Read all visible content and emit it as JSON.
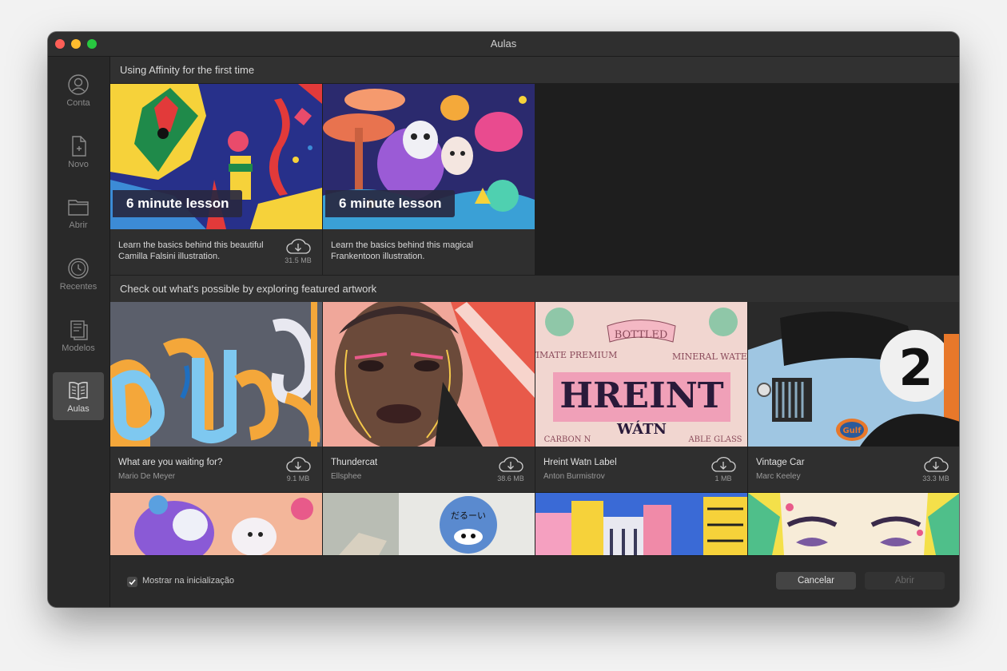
{
  "window": {
    "title": "Aulas"
  },
  "sidebar": {
    "items": [
      {
        "label": "Conta",
        "icon": "account-icon"
      },
      {
        "label": "Novo",
        "icon": "new-document-icon"
      },
      {
        "label": "Abrir",
        "icon": "folder-icon"
      },
      {
        "label": "Recentes",
        "icon": "recent-clock-icon"
      },
      {
        "label": "Modelos",
        "icon": "templates-icon"
      },
      {
        "label": "Aulas",
        "icon": "book-icon",
        "active": true
      }
    ]
  },
  "sections": {
    "first": {
      "title": "Using Affinity for the first time"
    },
    "featured": {
      "title": "Check out what's possible by exploring featured artwork"
    }
  },
  "lessons": [
    {
      "badge": "6 minute lesson",
      "description": "Learn the basics behind this beautiful Camilla Falsini illustration.",
      "size": "31.5 MB"
    },
    {
      "badge": "6 minute lesson",
      "description": "Learn the basics behind this magical Frankentoon illustration."
    }
  ],
  "featured": [
    {
      "title": "What are you waiting for?",
      "author": "Mario De Meyer",
      "size": "9.1 MB"
    },
    {
      "title": "Thundercat",
      "author": "Ellsphee",
      "size": "38.6 MB"
    },
    {
      "title": "Hreint Watn Label",
      "author": "Anton Burmistrov",
      "size": "1 MB"
    },
    {
      "title": "Vintage Car",
      "author": "Marc Keeley",
      "size": "33.3 MB"
    }
  ],
  "artwork_text": {
    "hreint_top": "BOTTLED",
    "hreint_left": "ULTIMATE PREMIUM",
    "hreint_right": "MINERAL WATER",
    "hreint_main": "HREINT",
    "hreint_sub": "WÁTN",
    "hreint_bottom_left": "CARBON N",
    "hreint_bottom_right": "ABLE GLASS",
    "car_number": "2",
    "car_brand": "Gulf",
    "panda_text": "だるーい"
  },
  "footer": {
    "show_on_startup_label": "Mostrar na inicialização",
    "show_on_startup_checked": true,
    "cancel_label": "Cancelar",
    "open_label": "Abrir"
  },
  "colors": {
    "window_bg": "#2b2b2b",
    "content_bg": "#1e1e1e",
    "sidebar_active": "#4a4a4a",
    "close": "#ff5f57",
    "minimize": "#febc2e",
    "zoom": "#28c840"
  }
}
